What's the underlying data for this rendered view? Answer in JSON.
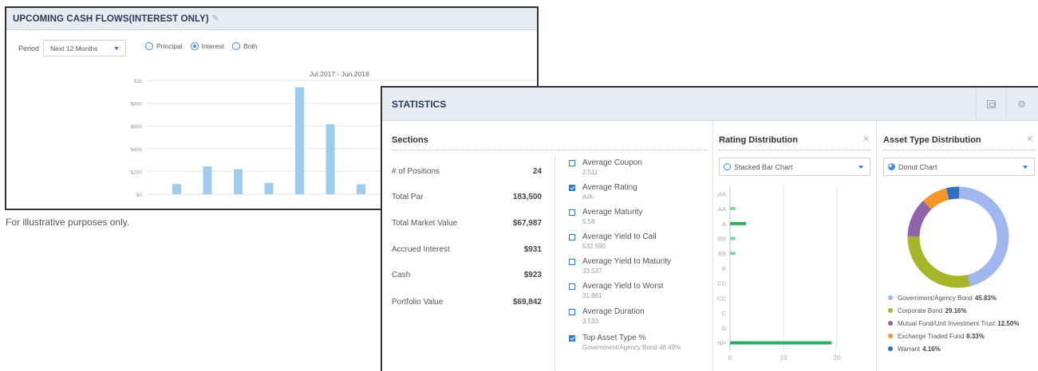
{
  "cashflows": {
    "title": "UPCOMING CASH FLOWS(INTEREST ONLY)",
    "period_label": "Period",
    "period_value": "Next 12 Months",
    "radios": [
      {
        "label": "Principal",
        "selected": false
      },
      {
        "label": "Interest",
        "selected": true
      },
      {
        "label": "Both",
        "selected": false
      }
    ],
    "range_label": "Jul.2017 - Jun.2018",
    "chart_data": {
      "type": "bar",
      "title": "Jul.2017 - Jun.2018",
      "ylim": [
        0,
        1000
      ],
      "yticks": [
        "$0",
        "$200",
        "$400",
        "$600",
        "$800",
        "$1k"
      ],
      "values": [
        90,
        245,
        220,
        100,
        940,
        615,
        88
      ],
      "bar_color": "#9fcbee"
    }
  },
  "caption": "For illustrative purposes only.",
  "statistics": {
    "title": "STATISTICS",
    "sections_title": "Sections",
    "stats": [
      {
        "label": "# of Positions",
        "value": "24"
      },
      {
        "label": "Total Par",
        "value": "183,500"
      },
      {
        "label": "Total Market Value",
        "value": "$67,987"
      },
      {
        "label": "Accrued Interest",
        "value": "$931"
      },
      {
        "label": "Cash",
        "value": "$923"
      },
      {
        "label": "Portfolio Value",
        "value": "$69,842"
      }
    ],
    "checks": [
      {
        "label": "Average Coupon",
        "sub": "2.511",
        "checked": false
      },
      {
        "label": "Average Rating",
        "sub": "A/A-",
        "checked": true
      },
      {
        "label": "Average Maturity",
        "sub": "5.58",
        "checked": false
      },
      {
        "label": "Average Yield to Call",
        "sub": "532.590",
        "checked": false
      },
      {
        "label": "Average Yield to Maturity",
        "sub": "33.537",
        "checked": false
      },
      {
        "label": "Average Yield to Worst",
        "sub": "31.861",
        "checked": false
      },
      {
        "label": "Average Duration",
        "sub": "3.533",
        "checked": false
      },
      {
        "label": "Top Asset Type %",
        "sub": "Government/Agency Bond 48.49%",
        "checked": true
      }
    ],
    "rating": {
      "title": "Rating Distribution",
      "chart_select": "Stacked Bar Chart",
      "chart_data": {
        "type": "bar",
        "orientation": "horizontal",
        "categories": [
          "AAA",
          "AA",
          "A",
          "BBB",
          "BB",
          "B",
          "CCC",
          "CC",
          "C",
          "D",
          "NR"
        ],
        "values": [
          0,
          1,
          3,
          1,
          1,
          0,
          0,
          0,
          0,
          0,
          19
        ],
        "xlim": [
          0,
          20
        ],
        "xticks": [
          "0",
          "10",
          "20"
        ],
        "color": "#27ae60"
      }
    },
    "asset": {
      "title": "Asset Type Distribution",
      "chart_select": "Donut Chart",
      "chart_data": {
        "type": "pie",
        "donut": true,
        "slices": [
          {
            "name": "Government/Agency Bond",
            "pct": "45.83%",
            "value": 45.83,
            "color": "#9fb7ee"
          },
          {
            "name": "Corporate Bond",
            "pct": "29.16%",
            "value": 29.16,
            "color": "#a7b52b"
          },
          {
            "name": "Mutual Fund/Unit Investment Trust",
            "pct": "12.50%",
            "value": 12.5,
            "color": "#8e63a8"
          },
          {
            "name": "Exchange Traded Fund",
            "pct": "8.33%",
            "value": 8.33,
            "color": "#f5962a"
          },
          {
            "name": "Warrant",
            "pct": "4.16%",
            "value": 4.16,
            "color": "#2f6fc0"
          }
        ]
      }
    }
  }
}
